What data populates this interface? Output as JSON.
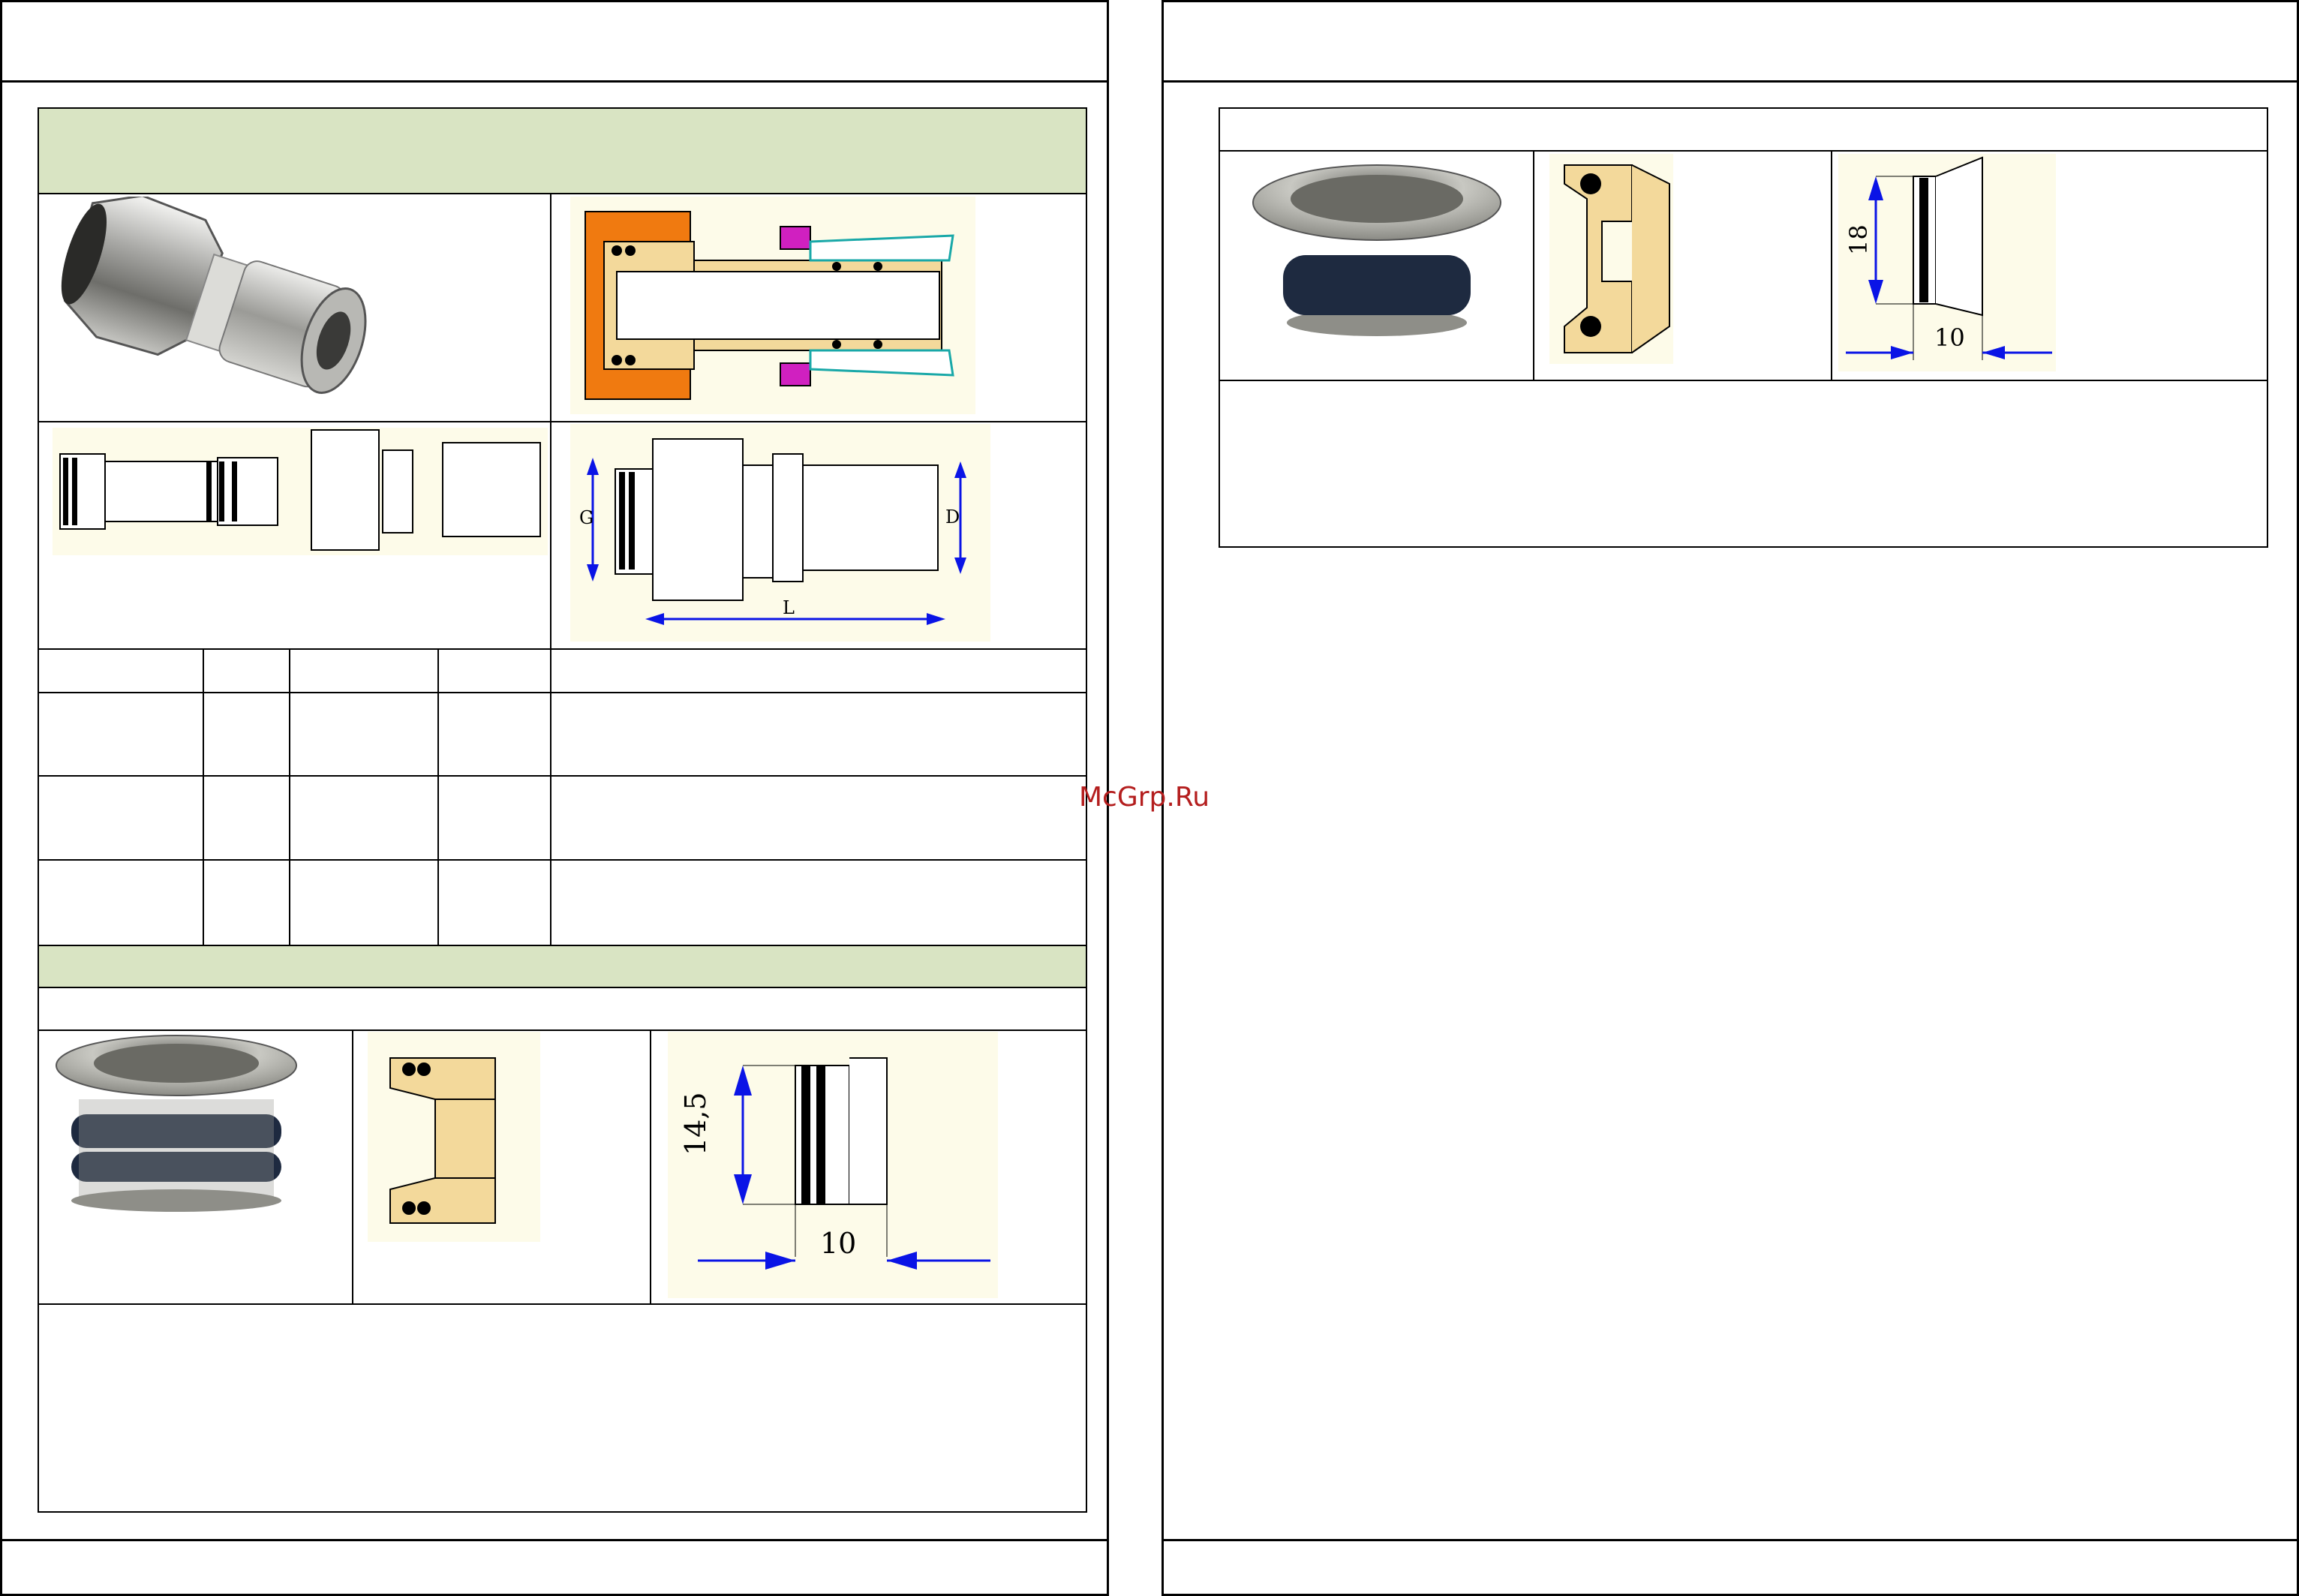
{
  "watermark": "McGrp.Ru",
  "colors": {
    "section_header": "#d9e4c3",
    "drawing_background": "#fdfbe9",
    "brass": "#f3d99b",
    "nut_orange": "#f07a10",
    "dimension_blue": "#0a14e6",
    "clip_magenta": "#d020c0",
    "sleeve_teal": "#19a8a8",
    "watermark_red": "#b41e1e"
  },
  "fitting_dimensions": {
    "thread_label": "G",
    "diameter_label": "D",
    "length_label": "L"
  },
  "insert_a": {
    "height": "14,5",
    "width": "10"
  },
  "insert_b": {
    "height": "18",
    "width": "10"
  }
}
